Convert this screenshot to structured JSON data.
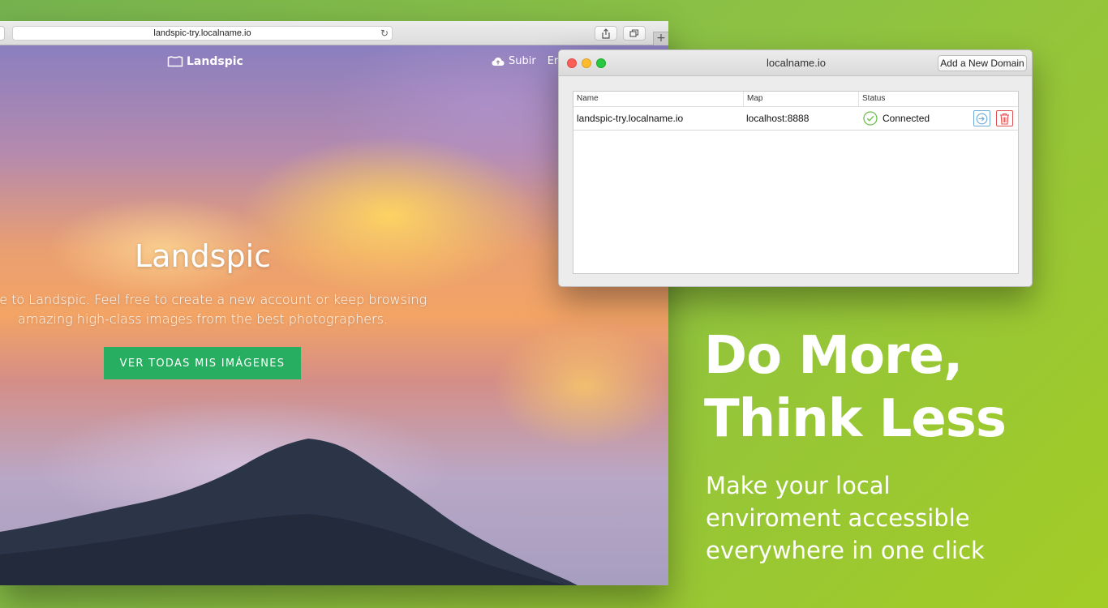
{
  "browser": {
    "address": "landspic-try.localname.io"
  },
  "site": {
    "logo_text": "Landspic",
    "nav": {
      "upload_label": "Subir",
      "truncated_label": "En"
    },
    "hero": {
      "title": "Landspic",
      "text_line1": "ome to Landspic. Feel free to create a new account or keep browsing",
      "text_line2": "amazing high-class images from the best photographers.",
      "cta_label": "VER TODAS MIS IMÁGENES"
    }
  },
  "app": {
    "title": "localname.io",
    "add_domain_label": "Add a New Domain",
    "table": {
      "columns": [
        "Name",
        "Map",
        "Status"
      ],
      "rows": [
        {
          "name": "landspic-try.localname.io",
          "map": "localhost:8888",
          "status": "Connected"
        }
      ]
    }
  },
  "marketing": {
    "headline_line1": "Do More,",
    "headline_line2": "Think Less",
    "subline_line1": "Make your local",
    "subline_line2": "enviroment accessible",
    "subline_line3": "everywhere in one click"
  },
  "colors": {
    "cta_green": "#27ae60",
    "status_green": "#6cc04a",
    "delete_red": "#e05050",
    "connect_blue": "#6ea9d8"
  }
}
